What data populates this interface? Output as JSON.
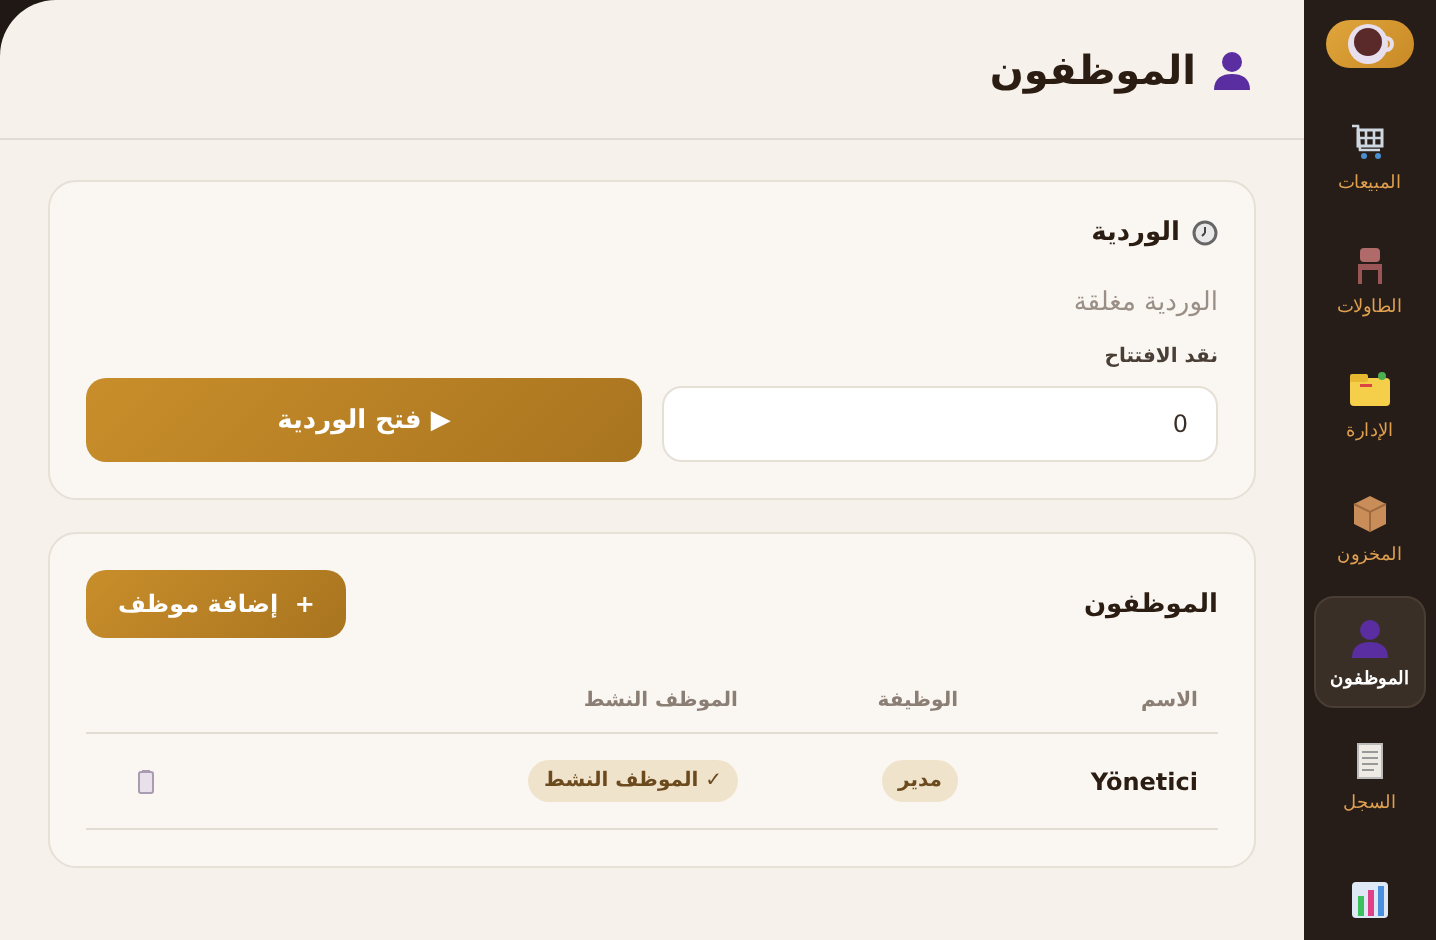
{
  "sidebar": {
    "items": [
      {
        "kind": "sales",
        "label": "المبيعات",
        "selected": false
      },
      {
        "kind": "tables",
        "label": "الطاولات",
        "selected": false
      },
      {
        "kind": "management",
        "label": "الإدارة",
        "selected": false
      },
      {
        "kind": "storage",
        "label": "المخزون",
        "selected": false
      },
      {
        "kind": "employees",
        "label": "الموظفون",
        "selected": true
      },
      {
        "kind": "log",
        "label": "السجل",
        "selected": false
      },
      {
        "kind": "reports",
        "selected": false
      }
    ]
  },
  "header": {
    "title": "الموظفون"
  },
  "shift": {
    "title": "الوردية",
    "status": "الوردية مغلقة",
    "cash_label": "نقد الافتتاح",
    "cash_value": "0",
    "button": "▶ فتح الوردية"
  },
  "employees": {
    "title": "الموظفون",
    "add_button": "+  إضافة موظف",
    "columns": [
      "الاسم",
      "الوظيفة",
      "الموظف النشط"
    ],
    "rows": [
      {
        "name": "Yönetici",
        "role": "مدير",
        "active": true,
        "active_label": "✓ الموظف النشط"
      }
    ]
  }
}
